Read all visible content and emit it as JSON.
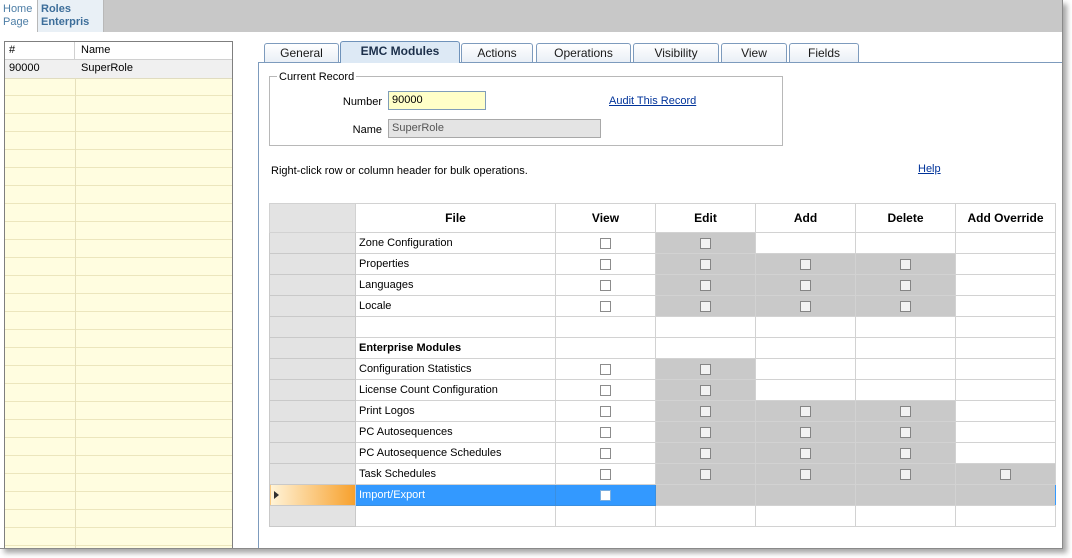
{
  "breadcrumbs": [
    {
      "line1": "Home",
      "line2": "Page"
    },
    {
      "line1": "Roles",
      "line2": "Enterpris"
    }
  ],
  "left_list": {
    "columns": [
      "#",
      "Name"
    ],
    "rows": [
      {
        "number": "90000",
        "name": "SuperRole"
      }
    ]
  },
  "tabs": [
    "General",
    "EMC Modules",
    "Actions",
    "Operations",
    "Visibility",
    "View",
    "Fields"
  ],
  "active_tab": "EMC Modules",
  "record": {
    "legend": "Current Record",
    "number_label": "Number",
    "number_value": "90000",
    "name_label": "Name",
    "name_value": "SuperRole",
    "audit_link": "Audit This Record"
  },
  "hint": "Right-click row or column header for bulk operations.",
  "help_link": "Help",
  "grid": {
    "columns": [
      "File",
      "View",
      "Edit",
      "Add",
      "Delete",
      "Add Override"
    ],
    "rows": [
      {
        "file": "Zone Configuration"
      },
      {
        "file": "Properties"
      },
      {
        "file": "Languages"
      },
      {
        "file": "Locale"
      },
      {
        "file": ""
      },
      {
        "file": "Enterprise Modules"
      },
      {
        "file": "Configuration Statistics"
      },
      {
        "file": "License Count Configuration"
      },
      {
        "file": "Print Logos"
      },
      {
        "file": "PC Autosequences"
      },
      {
        "file": "PC Autosequence Schedules"
      },
      {
        "file": "Task Schedules"
      },
      {
        "file": "Import/Export"
      },
      {
        "file": ""
      }
    ]
  }
}
